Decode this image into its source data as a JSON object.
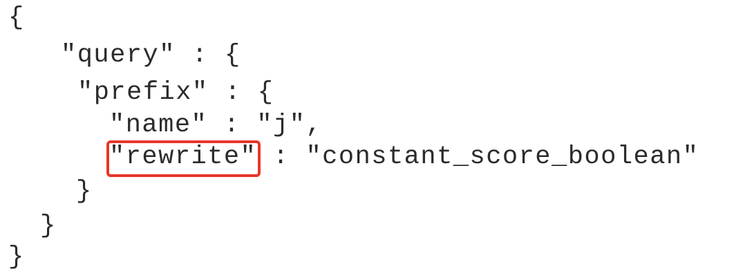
{
  "code": {
    "lines": [
      "{",
      "\"query\" : {",
      "\"prefix\" : {",
      "\"name\" : \"j\",",
      {
        "key": "\"rewrite\"",
        "rest": " : \"constant_score_boolean\""
      },
      "}",
      "}",
      "}"
    ]
  },
  "highlight": {
    "color": "#e8362a",
    "text": "\"rewrite\""
  }
}
